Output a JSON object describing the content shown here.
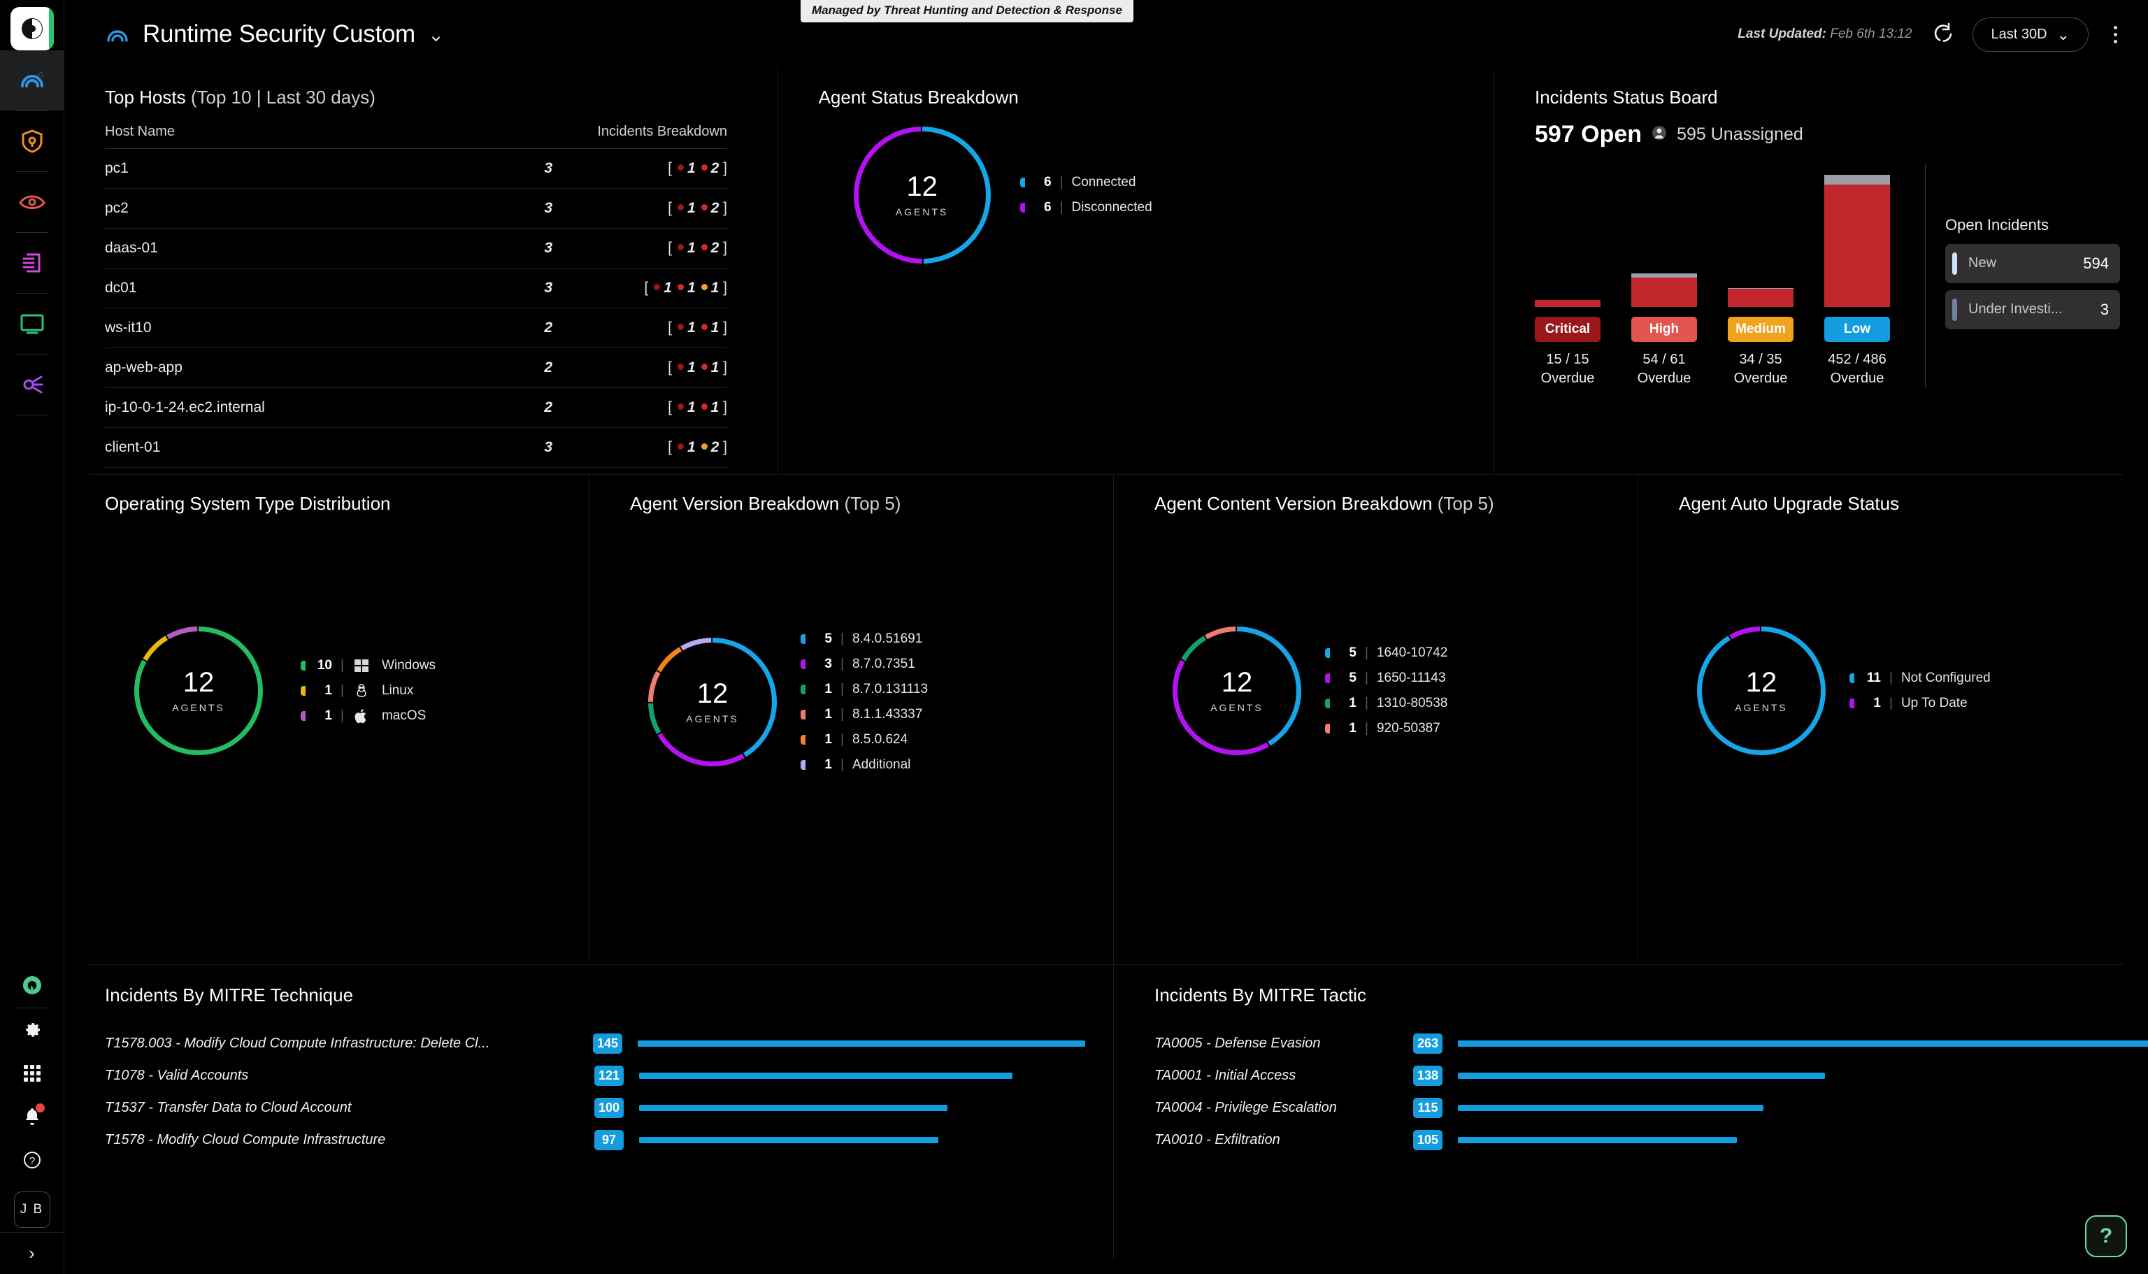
{
  "app": {
    "managed_banner": "Managed by Threat Hunting and Detection & Response",
    "page_title": "Runtime Security Custom",
    "title_caret": "⌄",
    "last_updated_label": "Last Updated:",
    "last_updated_value": "Feb 6th 13:12",
    "refresh_icon": "refresh-icon",
    "time_range": "Last 30D",
    "time_range_caret": "⌄",
    "kebab": "more-options-icon"
  },
  "sidebar": {
    "logo": "sentinelone-logo",
    "items": [
      {
        "name": "dashboard-icon",
        "color": "#2f93e0",
        "active": true
      },
      {
        "name": "shield-icon",
        "color": "#f0901e",
        "active": false
      },
      {
        "name": "eye-icon",
        "color": "#e1574f",
        "active": false
      },
      {
        "name": "script-icon",
        "color": "#d348d9",
        "active": false
      },
      {
        "name": "monitor-icon",
        "color": "#2bc47a",
        "active": false
      },
      {
        "name": "graph-icon",
        "color": "#a44df0",
        "active": false
      }
    ],
    "bottom": [
      {
        "name": "singularity-icon"
      },
      {
        "name": "gear-icon"
      },
      {
        "name": "apps-grid-icon"
      },
      {
        "name": "notifications-bell-icon",
        "badge": true
      },
      {
        "name": "help-circle-icon"
      }
    ],
    "avatar_initials": "J B",
    "expand_caret": "›"
  },
  "top_hosts": {
    "title": "Top Hosts",
    "subtitle": "(Top 10 | Last 30 days)",
    "columns": [
      "Host Name",
      "Incidents Breakdown"
    ],
    "rows": [
      {
        "host": "pc1",
        "count": "3",
        "breakdown": [
          {
            "sev": "critical",
            "n": "1"
          },
          {
            "sev": "high",
            "n": "2"
          }
        ]
      },
      {
        "host": "pc2",
        "count": "3",
        "breakdown": [
          {
            "sev": "critical",
            "n": "1"
          },
          {
            "sev": "high",
            "n": "2"
          }
        ]
      },
      {
        "host": "daas-01",
        "count": "3",
        "breakdown": [
          {
            "sev": "critical",
            "n": "1"
          },
          {
            "sev": "high",
            "n": "2"
          }
        ]
      },
      {
        "host": "dc01",
        "count": "3",
        "breakdown": [
          {
            "sev": "critical",
            "n": "1"
          },
          {
            "sev": "high",
            "n": "1"
          },
          {
            "sev": "medium",
            "n": "1"
          }
        ]
      },
      {
        "host": "ws-it10",
        "count": "2",
        "breakdown": [
          {
            "sev": "critical",
            "n": "1"
          },
          {
            "sev": "high",
            "n": "1"
          }
        ]
      },
      {
        "host": "ap-web-app",
        "count": "2",
        "breakdown": [
          {
            "sev": "critical",
            "n": "1"
          },
          {
            "sev": "high",
            "n": "1"
          }
        ]
      },
      {
        "host": "ip-10-0-1-24.ec2.internal",
        "count": "2",
        "breakdown": [
          {
            "sev": "critical",
            "n": "1"
          },
          {
            "sev": "high",
            "n": "1"
          }
        ]
      },
      {
        "host": "client-01",
        "count": "3",
        "breakdown": [
          {
            "sev": "critical",
            "n": "1"
          },
          {
            "sev": "medium",
            "n": "2"
          }
        ]
      }
    ],
    "severity_colors": {
      "critical": "#9c1717",
      "high": "#cf2b2b",
      "medium": "#f0a41e",
      "low": "#139cdf"
    }
  },
  "agent_status": {
    "title": "Agent Status Breakdown",
    "chart_data": {
      "type": "pie",
      "title": "Agent Status Breakdown",
      "center_value": "12",
      "center_label": "AGENTS",
      "total": 12,
      "categories": [
        "Connected",
        "Disconnected"
      ],
      "values": [
        6,
        6
      ],
      "colors": [
        "#15a6e8",
        "#b313ef"
      ],
      "legend": "right"
    }
  },
  "incidents_board": {
    "title": "Incidents Status Board",
    "open_count": "597 Open",
    "unassigned_icon": "user-unassigned-icon",
    "unassigned": "595 Unassigned",
    "chart_data": {
      "type": "bar",
      "title": "Incidents Status Board",
      "categories": [
        "Critical",
        "High",
        "Medium",
        "Low"
      ],
      "series": [
        {
          "name": "Overdue",
          "values": [
            15,
            54,
            34,
            452
          ]
        },
        {
          "name": "Total",
          "values": [
            15,
            61,
            35,
            486
          ]
        }
      ],
      "ylim": [
        0,
        486
      ]
    },
    "bars": [
      {
        "severity": "Critical",
        "overdue": "15",
        "total": "15",
        "overdue_label": "15 / 15",
        "overdue_word": "Overdue",
        "pill_bg": "#9c1717",
        "red_h": 10,
        "grey_h": 0
      },
      {
        "severity": "High",
        "overdue": "54",
        "total": "61",
        "overdue_label": "54 / 61",
        "overdue_word": "Overdue",
        "pill_bg": "#e2544d",
        "red_h": 42,
        "grey_h": 6
      },
      {
        "severity": "Medium",
        "overdue": "34",
        "total": "35",
        "overdue_label": "34 / 35",
        "overdue_word": "Overdue",
        "pill_bg": "#f0a41e",
        "red_h": 26,
        "grey_h": 1
      },
      {
        "severity": "Low",
        "overdue": "452",
        "total": "486",
        "overdue_label": "452 / 486",
        "overdue_word": "Overdue",
        "pill_bg": "#139cdf",
        "red_h": 175,
        "grey_h": 14
      }
    ],
    "open_incidents_title": "Open Incidents",
    "open_incidents": [
      {
        "label": "New",
        "value": "594",
        "color": "#cfe3f7"
      },
      {
        "label": "Under Investi...",
        "value": "3",
        "color": "#6f839a"
      }
    ]
  },
  "os_distribution": {
    "title": "Operating System Type Distribution",
    "chart_data": {
      "type": "pie",
      "title": "Operating System Type Distribution",
      "center_value": "12",
      "center_label": "AGENTS",
      "total": 12,
      "categories": [
        "Windows",
        "Linux",
        "macOS"
      ],
      "values": [
        10,
        1,
        1
      ],
      "colors": [
        "#24bc62",
        "#e8b90d",
        "#b05fc0"
      ],
      "icons": [
        "windows-icon",
        "linux-icon",
        "apple-icon"
      ],
      "legend": "right"
    }
  },
  "agent_version": {
    "title": "Agent Version Breakdown",
    "subtitle": "(Top 5)",
    "chart_data": {
      "type": "pie",
      "title": "Agent Version Breakdown (Top 5)",
      "center_value": "12",
      "center_label": "AGENTS",
      "total": 12,
      "categories": [
        "8.4.0.51691",
        "8.7.0.7351",
        "8.7.0.131113",
        "8.1.1.43337",
        "8.5.0.624",
        "Additional"
      ],
      "values": [
        5,
        3,
        1,
        1,
        1,
        1
      ],
      "colors": [
        "#15a6e8",
        "#b313ef",
        "#13a06f",
        "#ef7b72",
        "#f2821a",
        "#b9a7f0"
      ],
      "legend": "right"
    }
  },
  "agent_content_version": {
    "title": "Agent Content Version Breakdown",
    "subtitle": "(Top 5)",
    "chart_data": {
      "type": "pie",
      "title": "Agent Content Version Breakdown (Top 5)",
      "center_value": "12",
      "center_label": "AGENTS",
      "total": 12,
      "categories": [
        "1640-10742",
        "1650-11143",
        "1310-80538",
        "920-50387"
      ],
      "values": [
        5,
        5,
        1,
        1
      ],
      "colors": [
        "#15a6e8",
        "#b313ef",
        "#13a06f",
        "#ef7b72"
      ],
      "legend": "right"
    }
  },
  "agent_auto_upgrade": {
    "title": "Agent Auto Upgrade Status",
    "chart_data": {
      "type": "pie",
      "title": "Agent Auto Upgrade Status",
      "center_value": "12",
      "center_label": "AGENTS",
      "total": 12,
      "categories": [
        "Not Configured",
        "Up To Date"
      ],
      "values": [
        11,
        1
      ],
      "colors": [
        "#15a6e8",
        "#b313ef"
      ],
      "legend": "right"
    }
  },
  "mitre_technique": {
    "title": "Incidents By MITRE Technique",
    "chart_data": {
      "type": "bar",
      "title": "Incidents By MITRE Technique",
      "orientation": "horizontal",
      "categories": [
        "T1578.003 - Modify Cloud Compute Infrastructure: Delete Cl...",
        "T1078 - Valid Accounts",
        "T1537 - Transfer Data to Cloud Account",
        "T1578 - Modify Cloud Compute Infrastructure"
      ],
      "values": [
        145,
        121,
        100,
        97
      ],
      "max": 145,
      "bar_color": "#139cdf"
    }
  },
  "mitre_tactic": {
    "title": "Incidents By MITRE Tactic",
    "chart_data": {
      "type": "bar",
      "title": "Incidents By MITRE Tactic",
      "orientation": "horizontal",
      "categories": [
        "TA0005 - Defense Evasion",
        "TA0001 - Initial Access",
        "TA0004 - Privilege Escalation",
        "TA0010 - Exfiltration"
      ],
      "values": [
        263,
        138,
        115,
        105
      ],
      "max": 263,
      "bar_color": "#139cdf"
    }
  },
  "help_fab": {
    "glyph": "?"
  }
}
